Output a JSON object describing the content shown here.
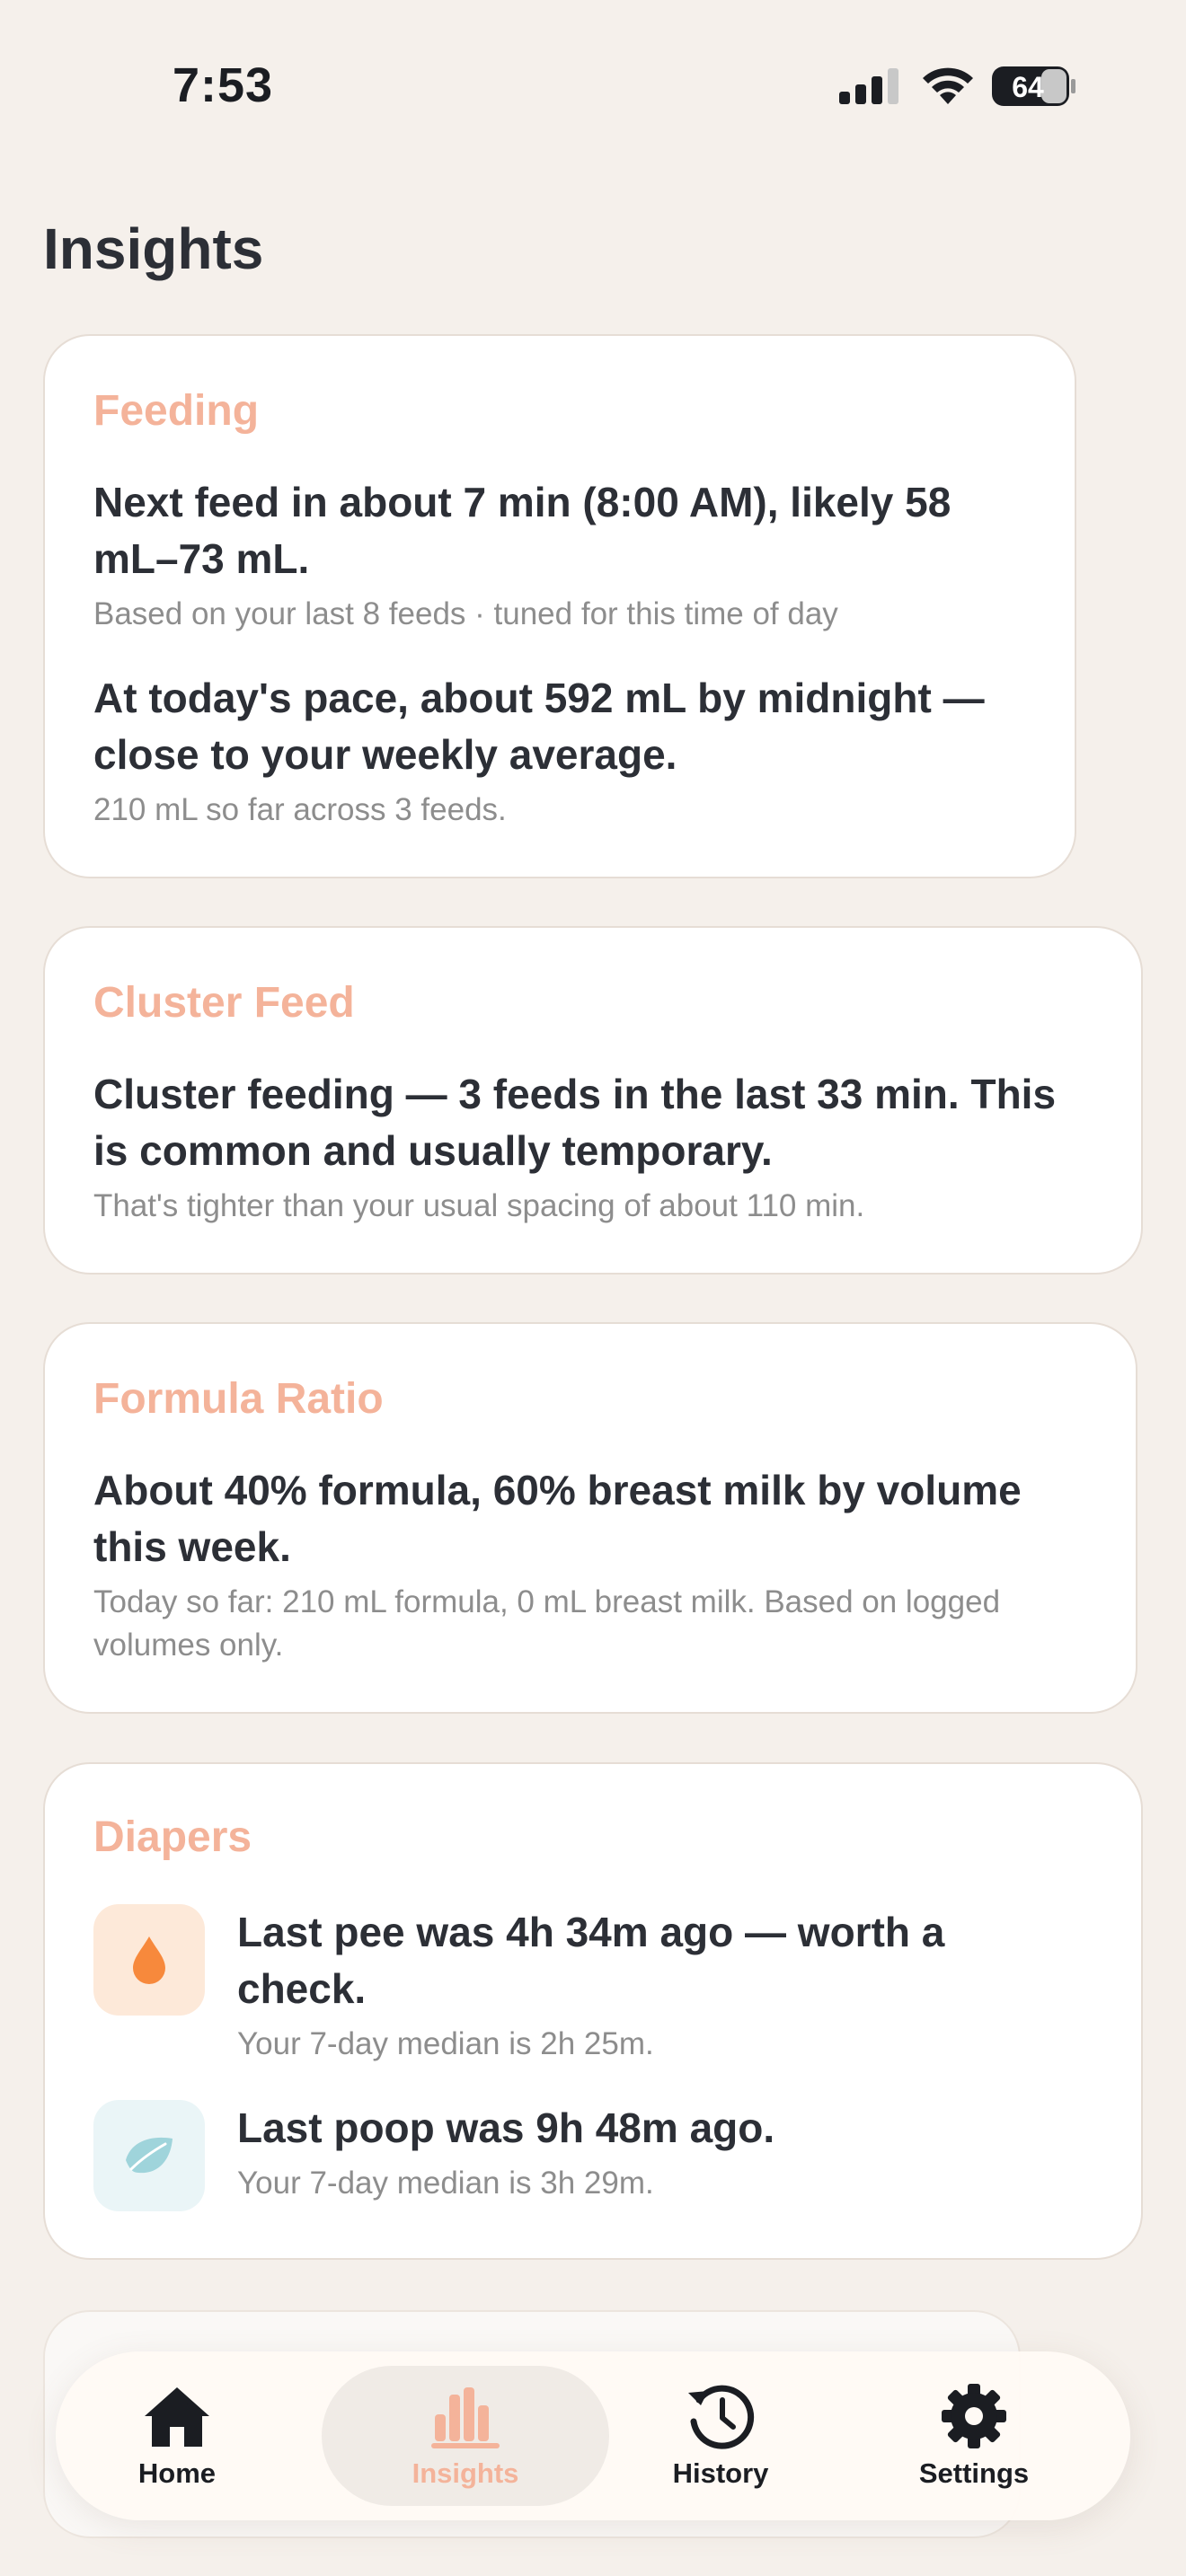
{
  "status_bar": {
    "time": "7:53",
    "battery": "64"
  },
  "page": {
    "title": "Insights"
  },
  "feeding": {
    "title": "Feeding",
    "next_feed": "Next feed in about 7 min (8:00 AM), likely 58 mL–73 mL.",
    "next_feed_note": "Based on your last 8 feeds · tuned for this time of day",
    "pace": "At today's pace, about 592 mL by midnight — close to your weekly average.",
    "pace_note": "210 mL so far across 3 feeds."
  },
  "cluster_feed": {
    "title": "Cluster Feed",
    "message": "Cluster feeding — 3 feeds in the last 33 min. This is common and usually temporary.",
    "note": "That's tighter than your usual spacing of about 110 min."
  },
  "formula_ratio": {
    "title": "Formula Ratio",
    "message": "About 40% formula, 60% breast milk by volume this week.",
    "note": "Today so far: 210 mL formula, 0 mL breast milk. Based on logged volumes only."
  },
  "diapers": {
    "title": "Diapers",
    "pee": {
      "icon": "drop-icon",
      "message": "Last pee was 4h 34m ago — worth a check.",
      "note": "Your 7-day median is 2h 25m."
    },
    "poop": {
      "icon": "leaf-icon",
      "message": "Last poop was 9h 48m ago.",
      "note": "Your 7-day median is 3h 29m."
    }
  },
  "tabs": [
    {
      "label": "Home",
      "icon": "home-icon",
      "active": false
    },
    {
      "label": "Insights",
      "icon": "chart-icon",
      "active": true
    },
    {
      "label": "History",
      "icon": "history-icon",
      "active": false
    },
    {
      "label": "Settings",
      "icon": "gear-icon",
      "active": false
    }
  ],
  "colors": {
    "background": "#f5f0eb",
    "accent": "#f4b39a",
    "text": "#2c2f36",
    "muted": "#8d8d8d",
    "pee_tint": "#fde9d9",
    "pee_icon": "#f7893c",
    "poop_tint": "#eaf5f7",
    "poop_icon": "#9fd4db"
  }
}
